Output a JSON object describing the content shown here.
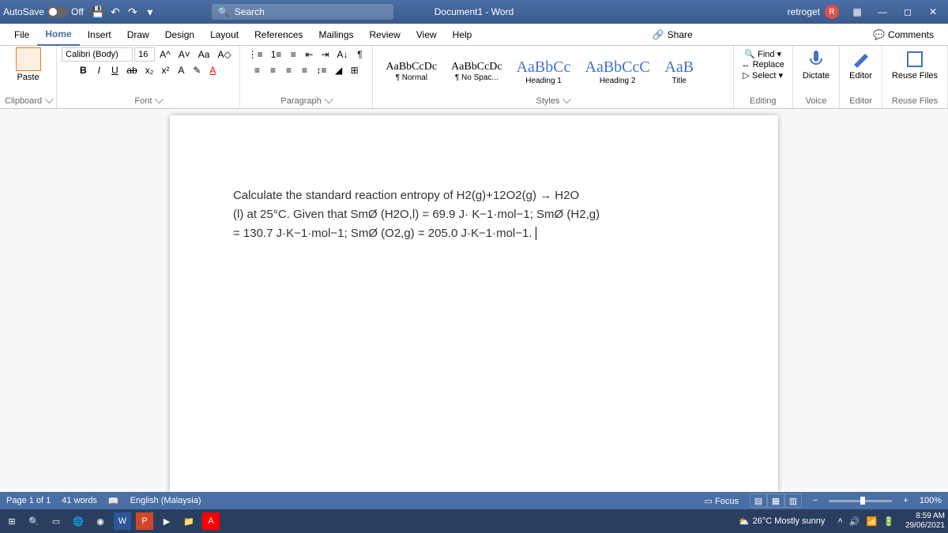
{
  "titlebar": {
    "autosave_label": "AutoSave",
    "autosave_state": "Off",
    "doc": "Document1 - Word",
    "search_placeholder": "Search",
    "user": "retroget",
    "user_initial": "R"
  },
  "tabs": [
    "File",
    "Home",
    "Insert",
    "Draw",
    "Design",
    "Layout",
    "References",
    "Mailings",
    "Review",
    "View",
    "Help"
  ],
  "active_tab": "Home",
  "share": "Share",
  "comments": "Comments",
  "ribbon": {
    "clipboard": {
      "label": "Clipboard",
      "paste": "Paste"
    },
    "font": {
      "label": "Font",
      "name": "Calibri (Body)",
      "size": "16",
      "bold": "B",
      "italic": "I",
      "underline": "U",
      "strike": "ab",
      "sub": "x₂",
      "sup": "x²",
      "grow": "A^",
      "shrink": "A˅",
      "case": "Aa",
      "clear": "A◇",
      "textfx": "A",
      "highlight": "✎",
      "color": "A"
    },
    "paragraph": {
      "label": "Paragraph"
    },
    "styles": {
      "label": "Styles",
      "items": [
        {
          "preview": "AaBbCcDc",
          "name": "¶ Normal"
        },
        {
          "preview": "AaBbCcDc",
          "name": "¶ No Spac..."
        },
        {
          "preview": "AaBbCc",
          "name": "Heading 1",
          "big": true
        },
        {
          "preview": "AaBbCcC",
          "name": "Heading 2",
          "big": true
        },
        {
          "preview": "AaB",
          "name": "Title",
          "big": true
        }
      ]
    },
    "editing": {
      "label": "Editing",
      "find": "Find",
      "replace": "Replace",
      "select": "Select"
    },
    "voice": {
      "label": "Voice",
      "dictate": "Dictate"
    },
    "editor": {
      "label": "Editor",
      "btn": "Editor"
    },
    "reuse": {
      "label": "Reuse Files",
      "btn": "Reuse Files"
    }
  },
  "document": {
    "line1": "Calculate the standard reaction entropy of H2(g)+12O2(g) → H2O",
    "line2": "(l) at 25°C. Given that SmØ (H2O,l) = 69.9 J· K−1·mol−1; SmØ (H2,g)",
    "line3": "= 130.7 J·K−1·mol−1; SmØ (O2,g) = 205.0 J·K−1·mol−1."
  },
  "status": {
    "page": "Page 1 of 1",
    "words": "41 words",
    "lang": "English (Malaysia)",
    "focus": "Focus",
    "zoom": "100%"
  },
  "taskbar": {
    "weather": "26°C Mostly sunny",
    "time": "8:59 AM",
    "date": "29/06/2021"
  }
}
